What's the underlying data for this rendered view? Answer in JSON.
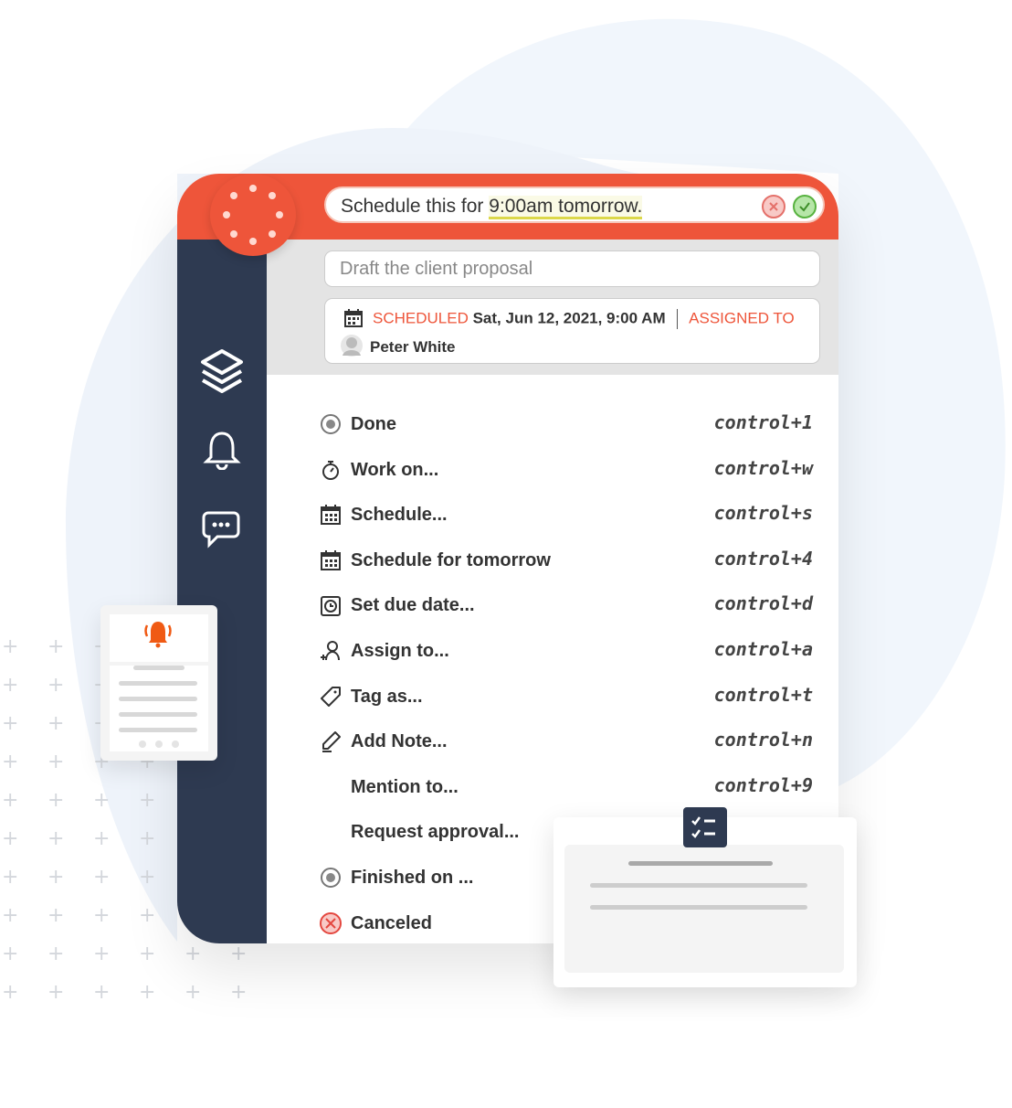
{
  "colors": {
    "accent": "#ee553a",
    "sidebar": "#2e3a51",
    "highlight": "#dcd84a"
  },
  "command": {
    "prefix": "Schedule this for ",
    "highlight": "9:00am tomorrow.",
    "cancel_icon": "x-circle-icon",
    "confirm_icon": "check-circle-icon"
  },
  "task": {
    "title": "Draft the client proposal"
  },
  "meta": {
    "scheduled_label": "SCHEDULED",
    "scheduled_value": "Sat, Jun 12, 2021, 9:00 AM",
    "assigned_label": "ASSIGNED TO",
    "assignee": "Peter White"
  },
  "sidebar": {
    "items": [
      {
        "icon": "layers-icon"
      },
      {
        "icon": "bell-icon"
      },
      {
        "icon": "chat-icon"
      }
    ]
  },
  "menu": [
    {
      "label": "Done",
      "shortcut": "control+1",
      "icon": "radio-icon"
    },
    {
      "label": "Work on...",
      "shortcut": "control+w",
      "icon": "stopwatch-icon"
    },
    {
      "label": "Schedule...",
      "shortcut": "control+s",
      "icon": "calendar-icon"
    },
    {
      "label": "Schedule for tomorrow",
      "shortcut": "control+4",
      "icon": "calendar-icon"
    },
    {
      "label": "Set due date...",
      "shortcut": "control+d",
      "icon": "alarm-icon"
    },
    {
      "label": "Assign to...",
      "shortcut": "control+a",
      "icon": "user-plus-icon"
    },
    {
      "label": "Tag as...",
      "shortcut": "control+t",
      "icon": "tag-icon"
    },
    {
      "label": "Add Note...",
      "shortcut": "control+n",
      "icon": "pencil-icon"
    },
    {
      "label": "Mention to...",
      "shortcut": "control+9",
      "icon": ""
    },
    {
      "label": "Request approval...",
      "shortcut": "",
      "icon": ""
    },
    {
      "label": "Finished on ...",
      "shortcut": "",
      "icon": "radio-icon"
    },
    {
      "label": "Canceled",
      "shortcut": "",
      "icon": "cancel-icon"
    }
  ]
}
